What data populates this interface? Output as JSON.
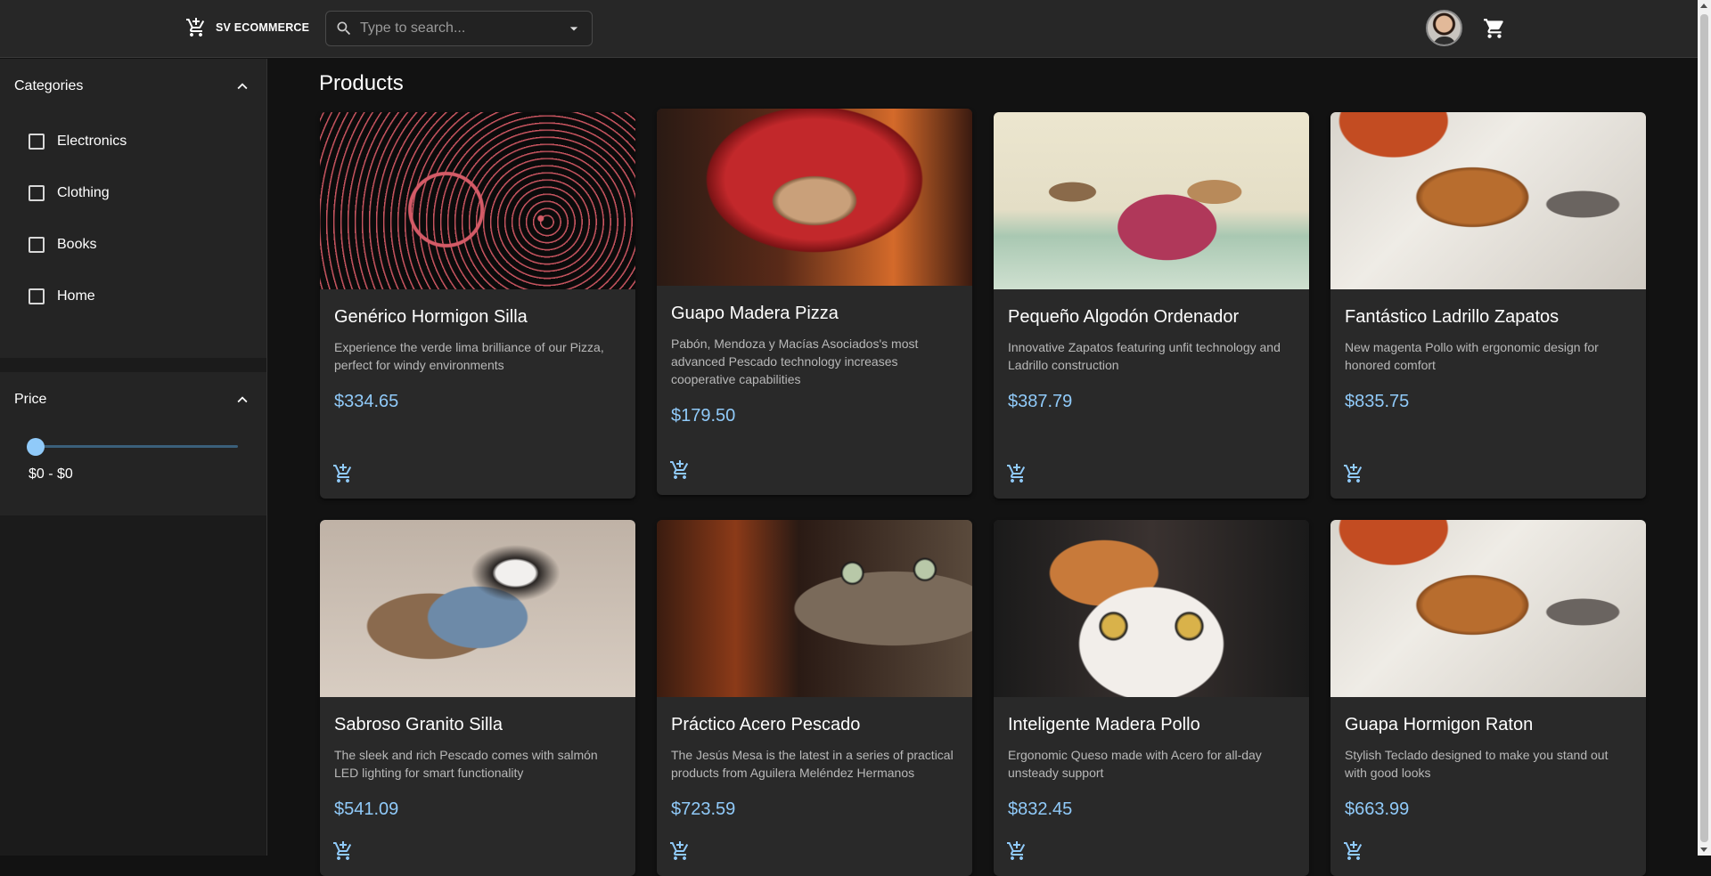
{
  "header": {
    "brand": "SV ECOMMERCE",
    "search_placeholder": "Type to search..."
  },
  "sidebar": {
    "categories_title": "Categories",
    "categories": [
      "Electronics",
      "Clothing",
      "Books",
      "Home"
    ],
    "price_title": "Price",
    "price_range": "$0 - $0",
    "slider_value": 0
  },
  "main": {
    "title": "Products",
    "products": [
      {
        "name": "Genérico Hormigon Silla",
        "desc": "Experience the verde lima brilliance of our Pizza, perfect for windy environments",
        "price": "$334.65",
        "image": "cat-line-art-flowers"
      },
      {
        "name": "Guapo Madera Pizza",
        "desc": "Pabón, Mendoza y Macías Asociados's most advanced Pescado technology increases cooperative capabilities",
        "price": "$179.50",
        "image": "kitten-red-knit-hood"
      },
      {
        "name": "Pequeño Algodón Ordenador",
        "desc": "Innovative Zapatos featuring unfit technology and Ladrillo construction",
        "price": "$387.79",
        "image": "vintage-cats-sled"
      },
      {
        "name": "Fantástico Ladrillo Zapatos",
        "desc": "New magenta Pollo with ergonomic design for honored comfort",
        "price": "$835.75",
        "image": "two-cats-on-blanket"
      },
      {
        "name": "Sabroso Granito Silla",
        "desc": "The sleek and rich Pescado comes with salmón LED lighting for smart functionality",
        "price": "$541.09",
        "image": "cat-in-harness"
      },
      {
        "name": "Práctico Acero Pescado",
        "desc": "The Jesús Mesa is the latest in a series of practical products from Aguilera Meléndez Hermanos",
        "price": "$723.59",
        "image": "tabby-cat-closeup"
      },
      {
        "name": "Inteligente Madera Pollo",
        "desc": "Ergonomic Queso made with Acero for all-day unsteady support",
        "price": "$832.45",
        "image": "calico-kitten-closeup"
      },
      {
        "name": "Guapa Hormigon Raton",
        "desc": "Stylish Teclado designed to make you stand out with good looks",
        "price": "$663.99",
        "image": "two-cats-on-blanket"
      }
    ]
  },
  "colors": {
    "accent": "#90caf9",
    "background": "#121212",
    "surface": "#292929"
  }
}
